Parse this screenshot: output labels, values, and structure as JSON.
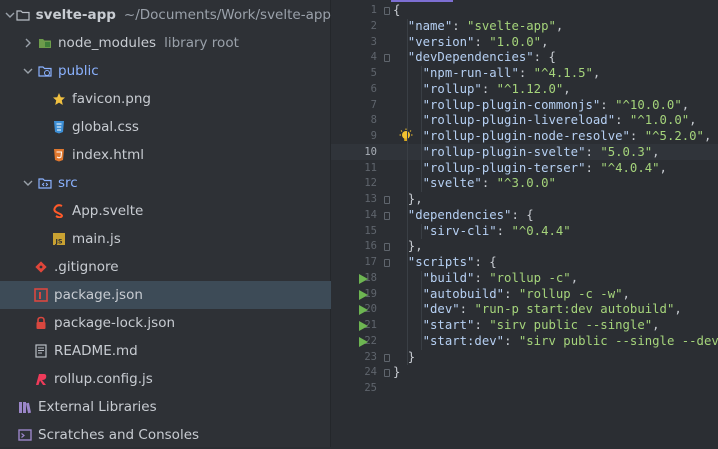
{
  "project": {
    "root_name": "svelte-app",
    "root_path": "~/Documents/Work/svelte-app",
    "items": [
      {
        "label": "node_modules",
        "suffix": "library root"
      },
      {
        "label": "public"
      },
      {
        "label": "favicon.png"
      },
      {
        "label": "global.css"
      },
      {
        "label": "index.html"
      },
      {
        "label": "src"
      },
      {
        "label": "App.svelte"
      },
      {
        "label": "main.js"
      },
      {
        "label": ".gitignore"
      },
      {
        "label": "package.json"
      },
      {
        "label": "package-lock.json"
      },
      {
        "label": "README.md"
      },
      {
        "label": "rollup.config.js"
      },
      {
        "label": "External Libraries"
      },
      {
        "label": "Scratches and Consoles"
      }
    ]
  },
  "editor": {
    "line_numbers": [
      "1",
      "2",
      "3",
      "4",
      "5",
      "6",
      "7",
      "8",
      "9",
      "10",
      "11",
      "12",
      "13",
      "14",
      "15",
      "16",
      "17",
      "18",
      "19",
      "20",
      "21",
      "22",
      "23",
      "24",
      "25"
    ],
    "current_line": "10",
    "lines": [
      [
        {
          "t": "{",
          "c": "p"
        }
      ],
      [
        {
          "t": "  \"name\"",
          "c": "k"
        },
        {
          "t": ": ",
          "c": "p"
        },
        {
          "t": "\"svelte-app\"",
          "c": "s"
        },
        {
          "t": ",",
          "c": "p"
        }
      ],
      [
        {
          "t": "  \"version\"",
          "c": "k"
        },
        {
          "t": ": ",
          "c": "p"
        },
        {
          "t": "\"1.0.0\"",
          "c": "s"
        },
        {
          "t": ",",
          "c": "p"
        }
      ],
      [
        {
          "t": "  \"devDependencies\"",
          "c": "k"
        },
        {
          "t": ": {",
          "c": "p"
        }
      ],
      [
        {
          "t": "    \"npm-run-all\"",
          "c": "k"
        },
        {
          "t": ": ",
          "c": "p"
        },
        {
          "t": "\"^4.1.5\"",
          "c": "s"
        },
        {
          "t": ",",
          "c": "p"
        }
      ],
      [
        {
          "t": "    \"rollup\"",
          "c": "k"
        },
        {
          "t": ": ",
          "c": "p"
        },
        {
          "t": "\"^1.12.0\"",
          "c": "s"
        },
        {
          "t": ",",
          "c": "p"
        }
      ],
      [
        {
          "t": "    \"rollup-plugin-commonjs\"",
          "c": "k"
        },
        {
          "t": ": ",
          "c": "p"
        },
        {
          "t": "\"^10.0.0\"",
          "c": "s"
        },
        {
          "t": ",",
          "c": "p"
        }
      ],
      [
        {
          "t": "    \"rollup-plugin-livereload\"",
          "c": "k"
        },
        {
          "t": ": ",
          "c": "p"
        },
        {
          "t": "\"^1.0.0\"",
          "c": "s"
        },
        {
          "t": ",",
          "c": "p"
        }
      ],
      [
        {
          "t": "    \"rollup-plugin-node-resolve\"",
          "c": "k"
        },
        {
          "t": ": ",
          "c": "p"
        },
        {
          "t": "\"^5.2.0\"",
          "c": "s"
        },
        {
          "t": ",",
          "c": "p"
        }
      ],
      [
        {
          "t": "    \"rollup-plugin-svelte\"",
          "c": "k"
        },
        {
          "t": ": ",
          "c": "p"
        },
        {
          "t": "\"5.0.3\"",
          "c": "s"
        },
        {
          "t": ",",
          "c": "p"
        }
      ],
      [
        {
          "t": "    \"rollup-plugin-terser\"",
          "c": "k"
        },
        {
          "t": ": ",
          "c": "p"
        },
        {
          "t": "\"^4.0.4\"",
          "c": "s"
        },
        {
          "t": ",",
          "c": "p"
        }
      ],
      [
        {
          "t": "    \"svelte\"",
          "c": "k"
        },
        {
          "t": ": ",
          "c": "p"
        },
        {
          "t": "\"^3.0.0\"",
          "c": "s"
        }
      ],
      [
        {
          "t": "  },",
          "c": "p"
        }
      ],
      [
        {
          "t": "  \"dependencies\"",
          "c": "k"
        },
        {
          "t": ": {",
          "c": "p"
        }
      ],
      [
        {
          "t": "    \"sirv-cli\"",
          "c": "k"
        },
        {
          "t": ": ",
          "c": "p"
        },
        {
          "t": "\"^0.4.4\"",
          "c": "s"
        }
      ],
      [
        {
          "t": "  },",
          "c": "p"
        }
      ],
      [
        {
          "t": "  \"scripts\"",
          "c": "k"
        },
        {
          "t": ": {",
          "c": "p"
        }
      ],
      [
        {
          "t": "    \"build\"",
          "c": "k"
        },
        {
          "t": ": ",
          "c": "p"
        },
        {
          "t": "\"rollup -c\"",
          "c": "s"
        },
        {
          "t": ",",
          "c": "p"
        }
      ],
      [
        {
          "t": "    \"autobuild\"",
          "c": "k"
        },
        {
          "t": ": ",
          "c": "p"
        },
        {
          "t": "\"rollup -c -w\"",
          "c": "s"
        },
        {
          "t": ",",
          "c": "p"
        }
      ],
      [
        {
          "t": "    \"dev\"",
          "c": "k"
        },
        {
          "t": ": ",
          "c": "p"
        },
        {
          "t": "\"run-p start:dev autobuild\"",
          "c": "s"
        },
        {
          "t": ",",
          "c": "p"
        }
      ],
      [
        {
          "t": "    \"start\"",
          "c": "k"
        },
        {
          "t": ": ",
          "c": "p"
        },
        {
          "t": "\"sirv public --single\"",
          "c": "s"
        },
        {
          "t": ",",
          "c": "p"
        }
      ],
      [
        {
          "t": "    \"start:dev\"",
          "c": "k"
        },
        {
          "t": ": ",
          "c": "p"
        },
        {
          "t": "\"sirv public --single --dev\"",
          "c": "s"
        }
      ],
      [
        {
          "t": "  }",
          "c": "p"
        }
      ],
      [
        {
          "t": "}",
          "c": "p"
        }
      ],
      [
        {
          "t": "",
          "c": "p"
        }
      ]
    ]
  },
  "icons": {
    "intention_bulb": "lightbulb-icon",
    "run_gutter": "run-arrow-icon"
  },
  "colors": {
    "accent": "#7d6fd3",
    "selection": "#3d4b57",
    "json_key": "#b6d0f3",
    "json_string": "#a5d47b",
    "run_green": "#6db552"
  }
}
